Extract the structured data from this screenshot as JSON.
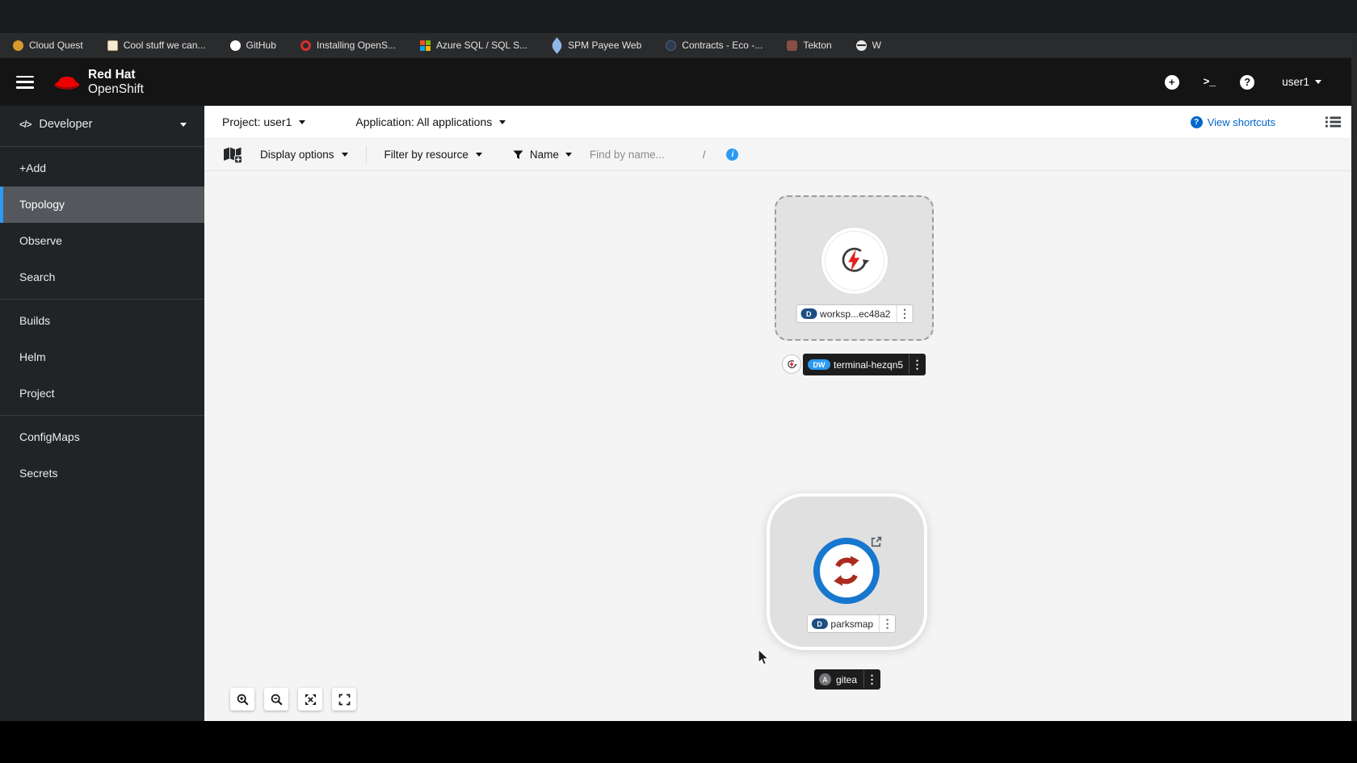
{
  "browser": {
    "bookmarks": [
      {
        "label": "Cloud Quest",
        "icon": "orange-circle"
      },
      {
        "label": "Cool stuff we can...",
        "icon": "beige-square"
      },
      {
        "label": "GitHub",
        "icon": "github"
      },
      {
        "label": "Installing OpenS...",
        "icon": "red-ring"
      },
      {
        "label": "Azure SQL / SQL S...",
        "icon": "microsoft-grid"
      },
      {
        "label": "SPM Payee Web",
        "icon": "blue-feather"
      },
      {
        "label": "Contracts - Eco -...",
        "icon": "dark-circle"
      },
      {
        "label": "Tekton",
        "icon": "red-mark"
      },
      {
        "label": "W",
        "icon": "globe"
      }
    ]
  },
  "masthead": {
    "brand_top": "Red Hat",
    "brand_bottom": "OpenShift",
    "plus_glyph": "+",
    "terminal_glyph": ">_",
    "help_glyph": "?",
    "user": "user1"
  },
  "sidebar": {
    "perspective": "Developer",
    "perspective_icon": "</>",
    "group1": [
      "+Add",
      "Topology",
      "Observe",
      "Search"
    ],
    "group2": [
      "Builds",
      "Helm",
      "Project"
    ],
    "group3": [
      "ConfigMaps",
      "Secrets"
    ],
    "active_item": "Topology"
  },
  "context_bar": {
    "project": "Project: user1",
    "application": "Application: All applications",
    "view_shortcuts": "View shortcuts",
    "qmark": "?"
  },
  "filter_bar": {
    "display_options": "Display options",
    "filter_by_resource": "Filter by resource",
    "name": "Name",
    "find_placeholder": "Find by name...",
    "shortcut": "/",
    "info_glyph": "i"
  },
  "topology": {
    "workspace": {
      "badge": "D",
      "label": "worksp...ec48a2",
      "kebab": "⋮"
    },
    "terminal": {
      "badge": "DW",
      "label": "terminal-hezqn5",
      "kebab": "⋮"
    },
    "parksmap": {
      "badge": "D",
      "label": "parksmap",
      "kebab": "⋮"
    },
    "gitea": {
      "badge": "A",
      "label": "gitea",
      "kebab": "⋮"
    }
  },
  "colors": {
    "brand_red": "#ee0000",
    "link_blue": "#0066cc",
    "badge_navy": "#1d4e82",
    "badge_dw_blue": "#2b9af3",
    "running_ring_blue": "#1777cf",
    "masthead_bg": "#141415",
    "sidebar_bg": "#212427",
    "active_nav_bg": "#54585c",
    "canvas_bg": "#f4f4f4"
  }
}
